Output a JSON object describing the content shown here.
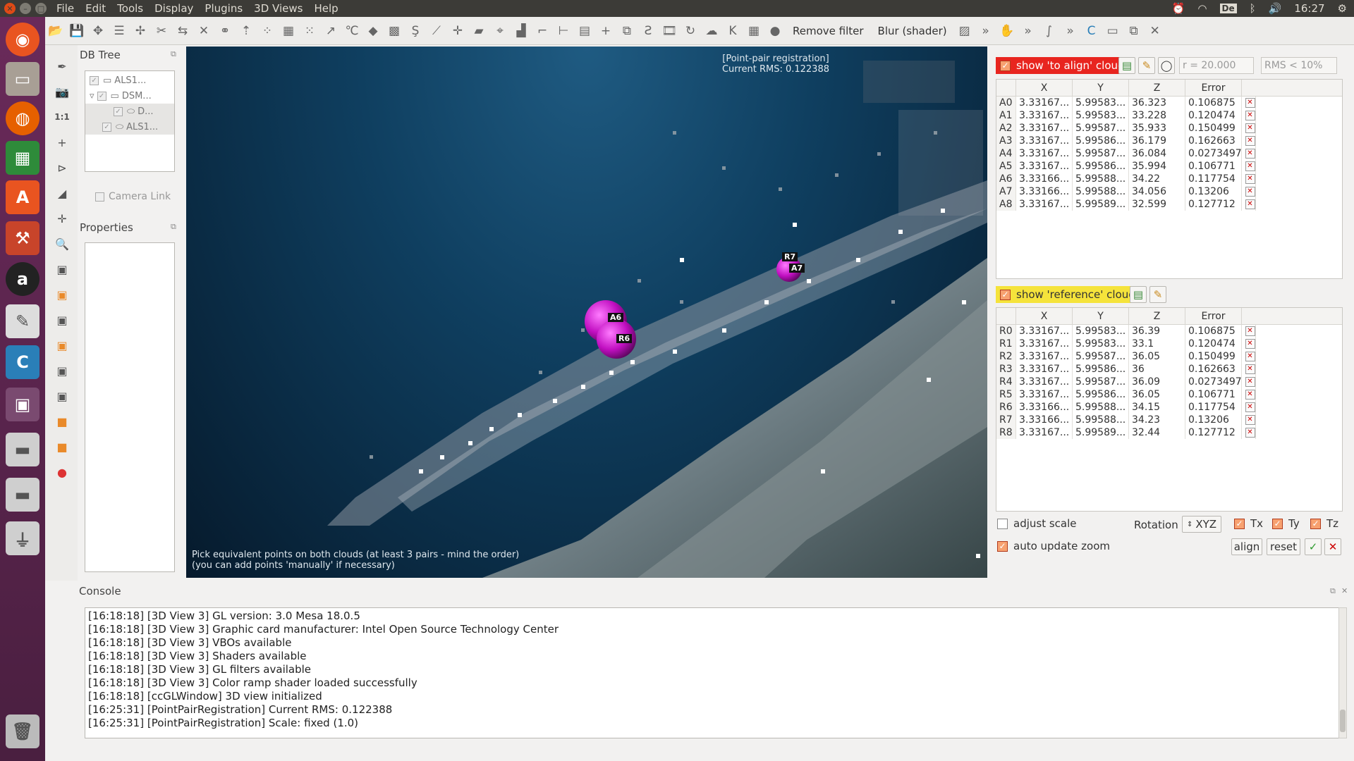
{
  "menubar": {
    "items": [
      "File",
      "Edit",
      "Tools",
      "Display",
      "Plugins",
      "3D Views",
      "Help"
    ],
    "clock": "16:27",
    "keyboard": "De"
  },
  "toolbar": {
    "remove_filter": "Remove filter",
    "blur_shader": "Blur (shader)"
  },
  "left": {
    "db_tree_title": "DB Tree",
    "tree_items": [
      "ALS1...",
      "DSM...",
      "D...",
      "ALS1..."
    ],
    "camera_link": "Camera Link",
    "properties_title": "Properties",
    "zoom_label": "1:1"
  },
  "view": {
    "registration_title": "[Point-pair registration]",
    "current_rms": "Current RMS: 0.122388",
    "hint_line1": "Pick equivalent points on both clouds (at least 3 pairs - mind the order)",
    "hint_line2": "(you can add points 'manually' if necessary)",
    "markers": [
      "A6",
      "R6",
      "R7",
      "A7"
    ]
  },
  "align_panel": {
    "show_to_align": "show 'to align' cloud",
    "radius": "r = 20.000",
    "rms_threshold": "RMS < 10%",
    "headers": [
      "X",
      "Y",
      "Z",
      "Error"
    ],
    "rows": [
      [
        "A0",
        "3.33167...",
        "5.99583...",
        "36.323",
        "0.106875"
      ],
      [
        "A1",
        "3.33167...",
        "5.99583...",
        "33.228",
        "0.120474"
      ],
      [
        "A2",
        "3.33167...",
        "5.99587...",
        "35.933",
        "0.150499"
      ],
      [
        "A3",
        "3.33167...",
        "5.99586...",
        "36.179",
        "0.162663"
      ],
      [
        "A4",
        "3.33167...",
        "5.99587...",
        "36.084",
        "0.0273497"
      ],
      [
        "A5",
        "3.33167...",
        "5.99586...",
        "35.994",
        "0.106771"
      ],
      [
        "A6",
        "3.33166...",
        "5.99588...",
        "34.22",
        "0.117754"
      ],
      [
        "A7",
        "3.33166...",
        "5.99588...",
        "34.056",
        "0.13206"
      ],
      [
        "A8",
        "3.33167...",
        "5.99589...",
        "32.599",
        "0.127712"
      ]
    ]
  },
  "ref_panel": {
    "show_reference": "show 'reference' cloud",
    "headers": [
      "X",
      "Y",
      "Z",
      "Error"
    ],
    "rows": [
      [
        "R0",
        "3.33167...",
        "5.99583...",
        "36.39",
        "0.106875"
      ],
      [
        "R1",
        "3.33167...",
        "5.99583...",
        "33.1",
        "0.120474"
      ],
      [
        "R2",
        "3.33167...",
        "5.99587...",
        "36.05",
        "0.150499"
      ],
      [
        "R3",
        "3.33167...",
        "5.99586...",
        "36",
        "0.162663"
      ],
      [
        "R4",
        "3.33167...",
        "5.99587...",
        "36.09",
        "0.0273497"
      ],
      [
        "R5",
        "3.33167...",
        "5.99586...",
        "36.05",
        "0.106771"
      ],
      [
        "R6",
        "3.33166...",
        "5.99588...",
        "34.15",
        "0.117754"
      ],
      [
        "R7",
        "3.33166...",
        "5.99588...",
        "34.23",
        "0.13206"
      ],
      [
        "R8",
        "3.33167...",
        "5.99589...",
        "32.44",
        "0.127712"
      ]
    ]
  },
  "options": {
    "adjust_scale": "adjust scale",
    "rotation_label": "Rotation",
    "rotation_value": "XYZ",
    "tx": "Tx",
    "ty": "Ty",
    "tz": "Tz",
    "auto_update_zoom": "auto update zoom",
    "align": "align",
    "reset": "reset"
  },
  "console": {
    "title": "Console",
    "lines": [
      "[16:18:18] [3D View 3] GL version: 3.0 Mesa 18.0.5",
      "[16:18:18] [3D View 3] Graphic card manufacturer: Intel Open Source Technology Center",
      "[16:18:18] [3D View 3] VBOs available",
      "[16:18:18] [3D View 3] Shaders available",
      "[16:18:18] [3D View 3] GL filters available",
      "[16:18:18] [3D View 3] Color ramp shader loaded successfully",
      "[16:18:18] [ccGLWindow] 3D view initialized",
      "[16:25:31] [PointPairRegistration] Current RMS: 0.122388",
      "[16:25:31] [PointPairRegistration] Scale: fixed (1.0)"
    ]
  },
  "colors": {
    "accent_red": "#e8251f",
    "accent_yellow": "#f5e33b",
    "marker_magenta": "#d11fd1"
  }
}
